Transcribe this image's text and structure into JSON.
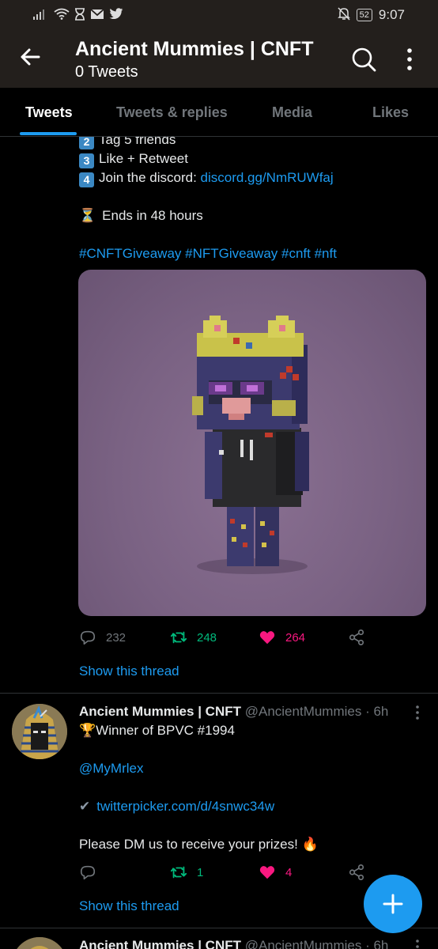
{
  "status_bar": {
    "battery": "52",
    "time": "9:07"
  },
  "header": {
    "title": "Ancient Mummies | CNFT",
    "subtitle": "0 Tweets"
  },
  "tabs": [
    {
      "label": "Tweets",
      "active": true
    },
    {
      "label": "Tweets & replies",
      "active": false
    },
    {
      "label": "Media",
      "active": false
    },
    {
      "label": "Likes",
      "active": false
    }
  ],
  "tweet1": {
    "step2_num": "2",
    "step2_text": "Tag 5 friends",
    "step3_num": "3",
    "step3_text": "Like + Retweet",
    "step4_num": "4",
    "step4_text": "Join the discord: ",
    "step4_link": "discord.gg/NmRUWfaj",
    "ends_emoji": "⏳",
    "ends_text": "Ends in 48 hours",
    "hashtags": "#CNFTGiveaway #NFTGiveaway #cnft #nft",
    "replies": "232",
    "retweets": "248",
    "likes": "264",
    "show_thread": "Show this thread"
  },
  "tweet2": {
    "name": "Ancient Mummies | CNFT",
    "handle": "@AncientMummies · 6h",
    "line1_emoji": "🏆",
    "line1_text": "Winner of BPVC #1994",
    "mention": "@MyMrlex",
    "check_emoji": "✔",
    "link": "twitterpicker.com/d/4snwc34w",
    "dm_text": "Please DM us to receive your prizes! ",
    "fire_emoji": "🔥",
    "replies": "",
    "retweets": "1",
    "likes": "4",
    "show_thread": "Show this thread"
  },
  "tweet3": {
    "name": "Ancient Mummies | CNFT",
    "handle": "@AncientMummies · 6h"
  },
  "icons": {
    "back": "arrow-left-icon",
    "search": "search-icon",
    "more": "more-vertical-icon",
    "reply": "reply-icon",
    "retweet": "retweet-icon",
    "like": "heart-icon",
    "share": "share-icon",
    "compose": "plus-icon"
  },
  "colors": {
    "accent": "#1d9bf0",
    "retweet": "#00ba7c",
    "like": "#f91880",
    "header_bg": "#231f1c"
  }
}
